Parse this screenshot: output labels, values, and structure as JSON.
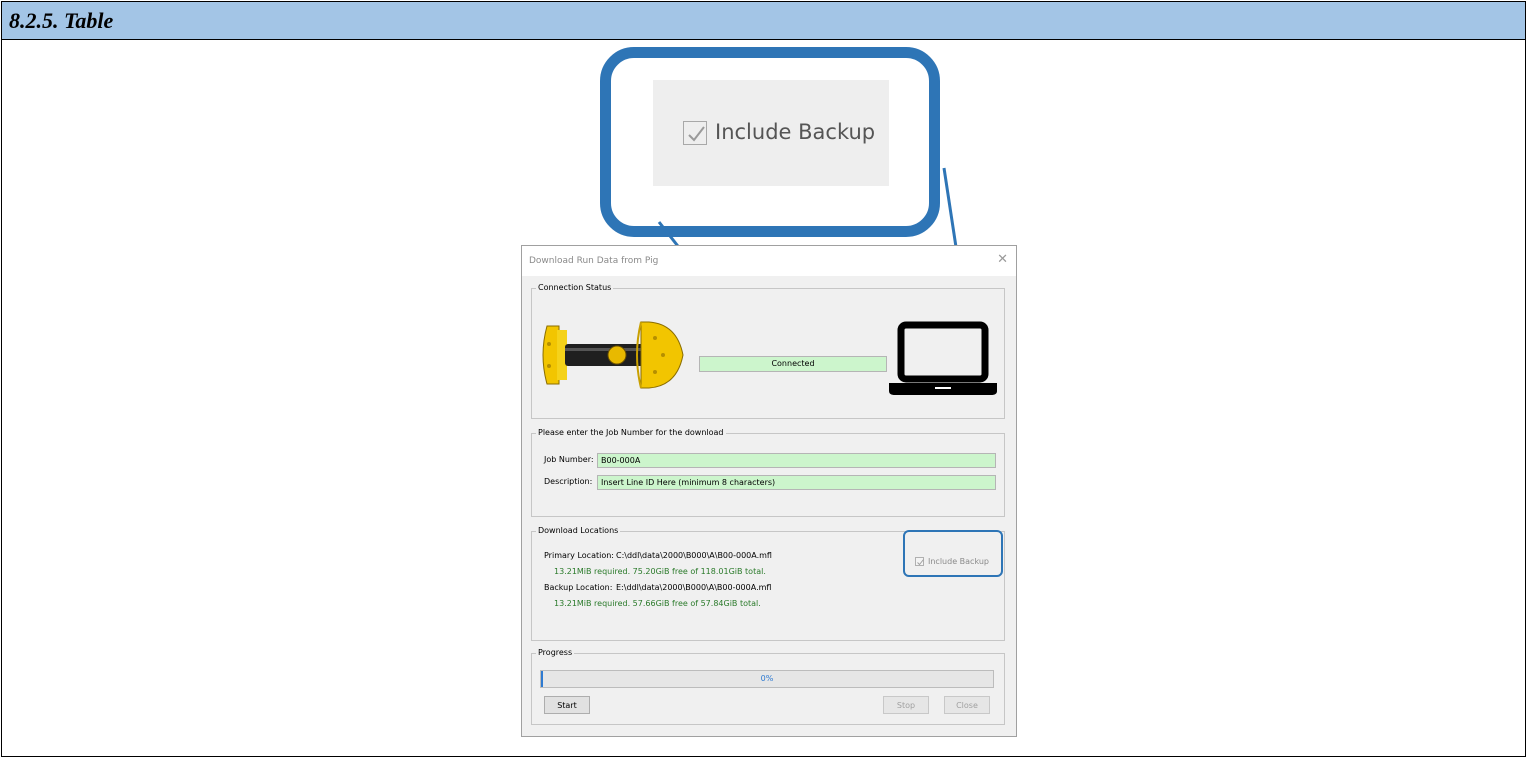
{
  "doc": {
    "title": "8.2.5. Table"
  },
  "zoom": {
    "checkbox_label": "Include Backup",
    "checked": true
  },
  "dialog": {
    "title": "Download Run Data from Pig",
    "close_icon": "close-icon",
    "connection": {
      "legend": "Connection Status",
      "status": "Connected",
      "status_color": "#ccf5cc",
      "device_icon": "pig-tool-icon",
      "computer_icon": "laptop-icon"
    },
    "job": {
      "legend": "Please enter the Job Number for the download",
      "job_label": "Job Number:",
      "job_value": "B00-000A",
      "desc_label": "Description:",
      "desc_value": "Insert Line ID Here (minimum 8 characters)"
    },
    "locations": {
      "legend": "Download Locations",
      "primary_label": "Primary Location:",
      "primary_path": "C:\\ddl\\data\\2000\\B000\\A\\B00-000A.mfl",
      "primary_space": "13.21MiB required. 75.20GiB free of 118.01GiB total.",
      "backup_label": "Backup Location:",
      "backup_path": "E:\\ddl\\data\\2000\\B000\\A\\B00-000A.mfl",
      "backup_space": "13.21MiB required. 57.66GiB free of 57.84GiB total.",
      "include_backup_label": "Include Backup",
      "include_backup_checked": true
    },
    "progress": {
      "legend": "Progress",
      "text": "0%",
      "fraction": 0.0
    },
    "buttons": {
      "start": "Start",
      "stop": "Stop",
      "close": "Close"
    }
  },
  "colors": {
    "accent": "#2e75b6",
    "header": "#a3c5e6",
    "field_green": "#ccf5cc",
    "space_text": "#2a7a2a"
  }
}
